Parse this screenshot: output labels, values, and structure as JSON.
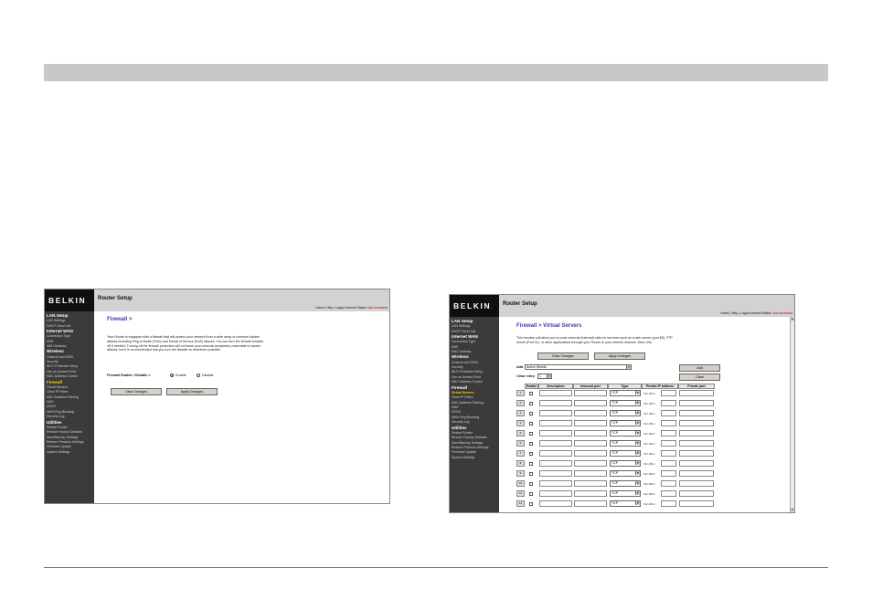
{
  "screenshot1": {
    "brand": "BELKIN",
    "app_title": "Router Setup",
    "header_links": {
      "home": "Home",
      "help": "Help",
      "logout": "Logout",
      "status_label": "Internet Status:",
      "status_value": "Not connected"
    },
    "sidebar": [
      {
        "label": "LAN Setup",
        "type": "heading"
      },
      {
        "label": "LAN Settings"
      },
      {
        "label": "DHCP Client List"
      },
      {
        "label": "Internet WAN",
        "type": "heading"
      },
      {
        "label": "Connection Type"
      },
      {
        "label": "DNS"
      },
      {
        "label": "MAC Address"
      },
      {
        "label": "Wireless",
        "type": "heading"
      },
      {
        "label": "Channel and SSID"
      },
      {
        "label": "Security"
      },
      {
        "label": "Wi-Fi Protected Setup"
      },
      {
        "label": "Use as Access Point"
      },
      {
        "label": "MAC Address Control"
      },
      {
        "label": "Firewall",
        "type": "heading",
        "active": true
      },
      {
        "label": "Virtual Servers"
      },
      {
        "label": "Client IP Filters"
      },
      {
        "label": "MAC Address Filtering"
      },
      {
        "label": "DMZ"
      },
      {
        "label": "DDNS"
      },
      {
        "label": "WAN Ping Blocking"
      },
      {
        "label": "Security Log"
      },
      {
        "label": "Utilities",
        "type": "heading"
      },
      {
        "label": "Restart Router"
      },
      {
        "label": "Restore Factory Defaults"
      },
      {
        "label": "Save/Backup Settings"
      },
      {
        "label": "Restore Previous Settings"
      },
      {
        "label": "Firmware Update"
      },
      {
        "label": "System Settings"
      }
    ],
    "page_title": "Firewall >",
    "description": [
      "Your Router is equipped with a firewall that will protect your network from a wide array of common hacker",
      "attacks including Ping of Death (PoD) and Denial of Service (DoS) attacks. You can turn the firewall function",
      "off if needed. Turning off the firewall protection will not leave your network completely vulnerable to hacker",
      "attacks, but it is recommended that you turn the firewall on whenever possible."
    ],
    "firewall_label": "Firewall Enable / Disable >",
    "enable_label": "Enable",
    "disable_label": "Disable",
    "enabled": true,
    "clear_button": "Clear Changes",
    "apply_button": "Apply Changes"
  },
  "screenshot2": {
    "brand": "BELKIN",
    "app_title": "Router Setup",
    "header_links": {
      "home": "Home",
      "help": "Help",
      "logout": "Logout",
      "status_label": "Internet Status:",
      "status_value": "Not connected"
    },
    "sidebar": [
      {
        "label": "LAN Setup",
        "type": "heading"
      },
      {
        "label": "LAN Settings"
      },
      {
        "label": "DHCP Client List"
      },
      {
        "label": "Internet WAN",
        "type": "heading"
      },
      {
        "label": "Connection Type"
      },
      {
        "label": "DNS"
      },
      {
        "label": "MAC Address"
      },
      {
        "label": "Wireless",
        "type": "heading"
      },
      {
        "label": "Channel and SSID"
      },
      {
        "label": "Security"
      },
      {
        "label": "Wi-Fi Protected Setup"
      },
      {
        "label": "Use as Access Point"
      },
      {
        "label": "MAC Address Control"
      },
      {
        "label": "Firewall",
        "type": "heading"
      },
      {
        "label": "Virtual Servers",
        "active": true
      },
      {
        "label": "Client IP Filters"
      },
      {
        "label": "MAC Address Filtering"
      },
      {
        "label": "DMZ"
      },
      {
        "label": "DDNS"
      },
      {
        "label": "WAN Ping Blocking"
      },
      {
        "label": "Security Log"
      },
      {
        "label": "Utilities",
        "type": "heading"
      },
      {
        "label": "Restart Router"
      },
      {
        "label": "Restore Factory Defaults"
      },
      {
        "label": "Save/Backup Settings"
      },
      {
        "label": "Restore Previous Settings"
      },
      {
        "label": "Firmware Update"
      },
      {
        "label": "System Settings"
      }
    ],
    "page_title": "Firewall > Virtual Servers",
    "description": [
      "This function will allow you to route external (Internet) calls for services such as a web server (port 80), FTP",
      "server (Port 21), or other applications through your Router to your internal network. More Info"
    ],
    "clear_button": "Clear Changes",
    "apply_button": "Apply Changes",
    "add_label": "Add",
    "add_select_value": "Active Worlds",
    "add_button": "Add",
    "clear_entry_label": "Clear entry",
    "clear_entry_value": "1",
    "clear_button2": "Clear",
    "table_headers": [
      "Enable",
      "Description",
      "Inbound port",
      "Type",
      "Private IP address",
      "Private port"
    ],
    "rows": [
      {
        "index": "1",
        "type": "TCP",
        "ip_prefix": "192.168.2."
      },
      {
        "index": "2",
        "type": "TCP",
        "ip_prefix": "192.168.2."
      },
      {
        "index": "3",
        "type": "TCP",
        "ip_prefix": "192.168.2."
      },
      {
        "index": "4",
        "type": "TCP",
        "ip_prefix": "192.168.2."
      },
      {
        "index": "5",
        "type": "TCP",
        "ip_prefix": "192.168.2."
      },
      {
        "index": "6",
        "type": "TCP",
        "ip_prefix": "192.168.2."
      },
      {
        "index": "7",
        "type": "TCP",
        "ip_prefix": "192.168.2."
      },
      {
        "index": "8",
        "type": "TCP",
        "ip_prefix": "192.168.2."
      },
      {
        "index": "9",
        "type": "TCP",
        "ip_prefix": "192.168.2."
      },
      {
        "index": "10",
        "type": "TCP",
        "ip_prefix": "192.168.2."
      },
      {
        "index": "11",
        "type": "TCP",
        "ip_prefix": "192.168.2."
      },
      {
        "index": "12",
        "type": "TCP",
        "ip_prefix": "192.168.2."
      }
    ]
  }
}
